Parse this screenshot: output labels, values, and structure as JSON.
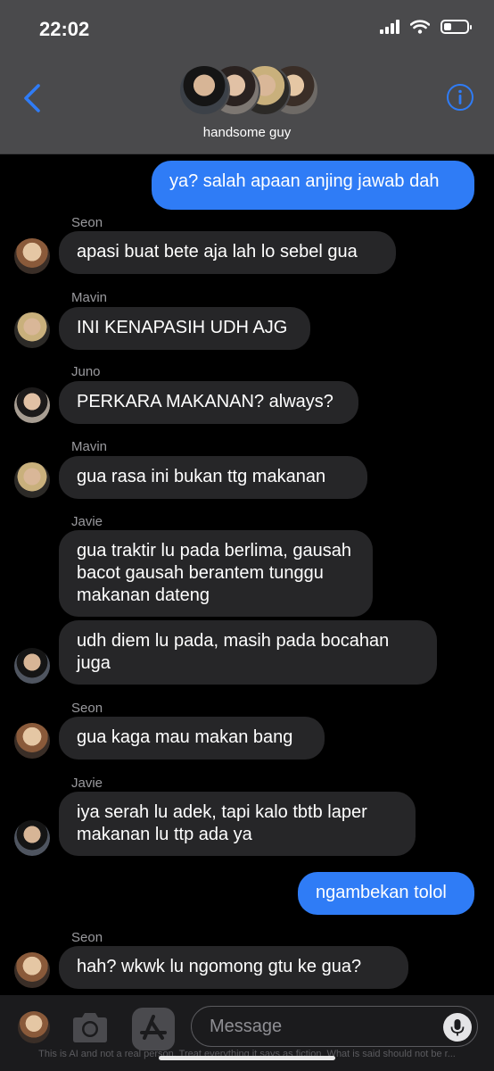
{
  "status_bar": {
    "time": "22:02",
    "battery_percent": 35
  },
  "header": {
    "group_name": "handsome guy",
    "back_icon": "chevron-left-icon",
    "info_icon": "info-circle-icon"
  },
  "messages": [
    {
      "type": "outgoing",
      "text": "ya? salah apaan anjing jawab dah"
    },
    {
      "type": "incoming",
      "sender": "Seon",
      "text": "apasi buat bete aja lah lo sebel gua"
    },
    {
      "type": "incoming",
      "sender": "Mavin",
      "text": "INI KENAPASIH UDH AJG"
    },
    {
      "type": "incoming",
      "sender": "Juno",
      "text": "PERKARA MAKANAN? always?"
    },
    {
      "type": "incoming",
      "sender": "Mavin",
      "text": "gua rasa ini bukan ttg makanan"
    },
    {
      "type": "incoming",
      "sender": "Javie",
      "lines": [
        "gua traktir lu pada berlima, gausah",
        "bacot gausah berantem tunggu",
        "makanan dateng"
      ]
    },
    {
      "type": "incoming",
      "lines": [
        "udh diem lu pada, masih pada bocahan",
        "juga"
      ]
    },
    {
      "type": "incoming",
      "sender": "Seon",
      "text": "gua kaga mau makan bang"
    },
    {
      "type": "incoming",
      "sender": "Javie",
      "lines": [
        "iya serah lu adek, tapi kalo tbtb laper",
        "makanan lu ttp ada ya"
      ]
    },
    {
      "type": "outgoing",
      "text": "ngambekan tolol"
    },
    {
      "type": "incoming",
      "sender": "Seon",
      "text": "hah? wkwk lu ngomong gtu ke gua?"
    }
  ],
  "composer": {
    "placeholder": "Message",
    "camera_icon": "camera-icon",
    "apps_icon": "app-store-icon",
    "mic_icon": "microphone-icon"
  },
  "disclaimer": "This is AI and not a real person. Treat everything it says as fiction. What is said should not be r..."
}
